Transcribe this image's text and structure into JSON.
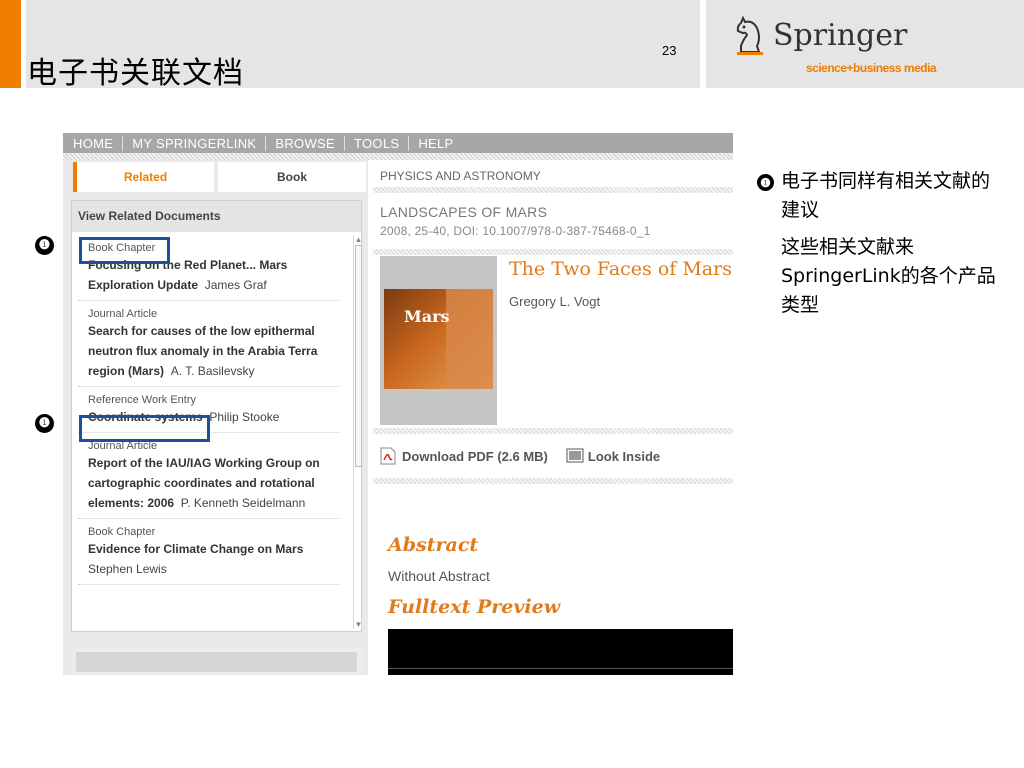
{
  "slide": {
    "title": "电子书关联文档",
    "page_number": "23",
    "brand_orange": "#ef7d00",
    "header_gray": "#e5e5e5"
  },
  "logo": {
    "icon": "knight-chess-icon",
    "name": "Springer",
    "tagline": "science+business media"
  },
  "screenshot": {
    "nav": [
      "HOME",
      "MY SPRINGERLINK",
      "BROWSE",
      "TOOLS",
      "HELP"
    ],
    "tabs": {
      "related": "Related",
      "book": "Book"
    },
    "related_panel": {
      "heading": "View Related Documents",
      "entries": [
        {
          "type": "Book Chapter",
          "title": "Focusing on the Red Planet... Mars Exploration Update",
          "author": "James Graf"
        },
        {
          "type": "Journal Article",
          "title": "Search for causes of the low epithermal neutron flux anomaly in the Arabia Terra region (Mars)",
          "author": "A. T. Basilevsky"
        },
        {
          "type": "Reference Work Entry",
          "title": "Coordinate systems",
          "author": "Philip Stooke"
        },
        {
          "type": "Journal Article",
          "title": "Report of the IAU/IAG Working Group on cartographic coordinates and rotational elements: 2006",
          "author": "P. Kenneth Seidelmann"
        },
        {
          "type": "Book Chapter",
          "title": "Evidence for Climate Change on Mars",
          "author": "Stephen Lewis"
        }
      ]
    },
    "content": {
      "breadcrumb": "PHYSICS AND ASTRONOMY",
      "book_series": "LANDSCAPES OF MARS",
      "meta": "2008, 25-40, DOI: 10.1007/978-0-387-75468-0_1",
      "cover_title": "Mars",
      "chapter_title": "The Two Faces of Mars",
      "chapter_author": "Gregory L. Vogt",
      "download_label": "Download PDF (2.6 MB)",
      "look_inside_label": "Look Inside",
      "abstract_heading": "Abstract",
      "abstract_text": "Without Abstract",
      "fulltext_heading": "Fulltext Preview",
      "accent_color": "#e07a1a"
    }
  },
  "annotations": {
    "marker_glyph": "❶",
    "highlight_color": "#1f4e9c",
    "note_line1": "电子书同样有相关文献的建议",
    "note_line2": "这些相关文献来SpringerLink的各个产品类型"
  }
}
